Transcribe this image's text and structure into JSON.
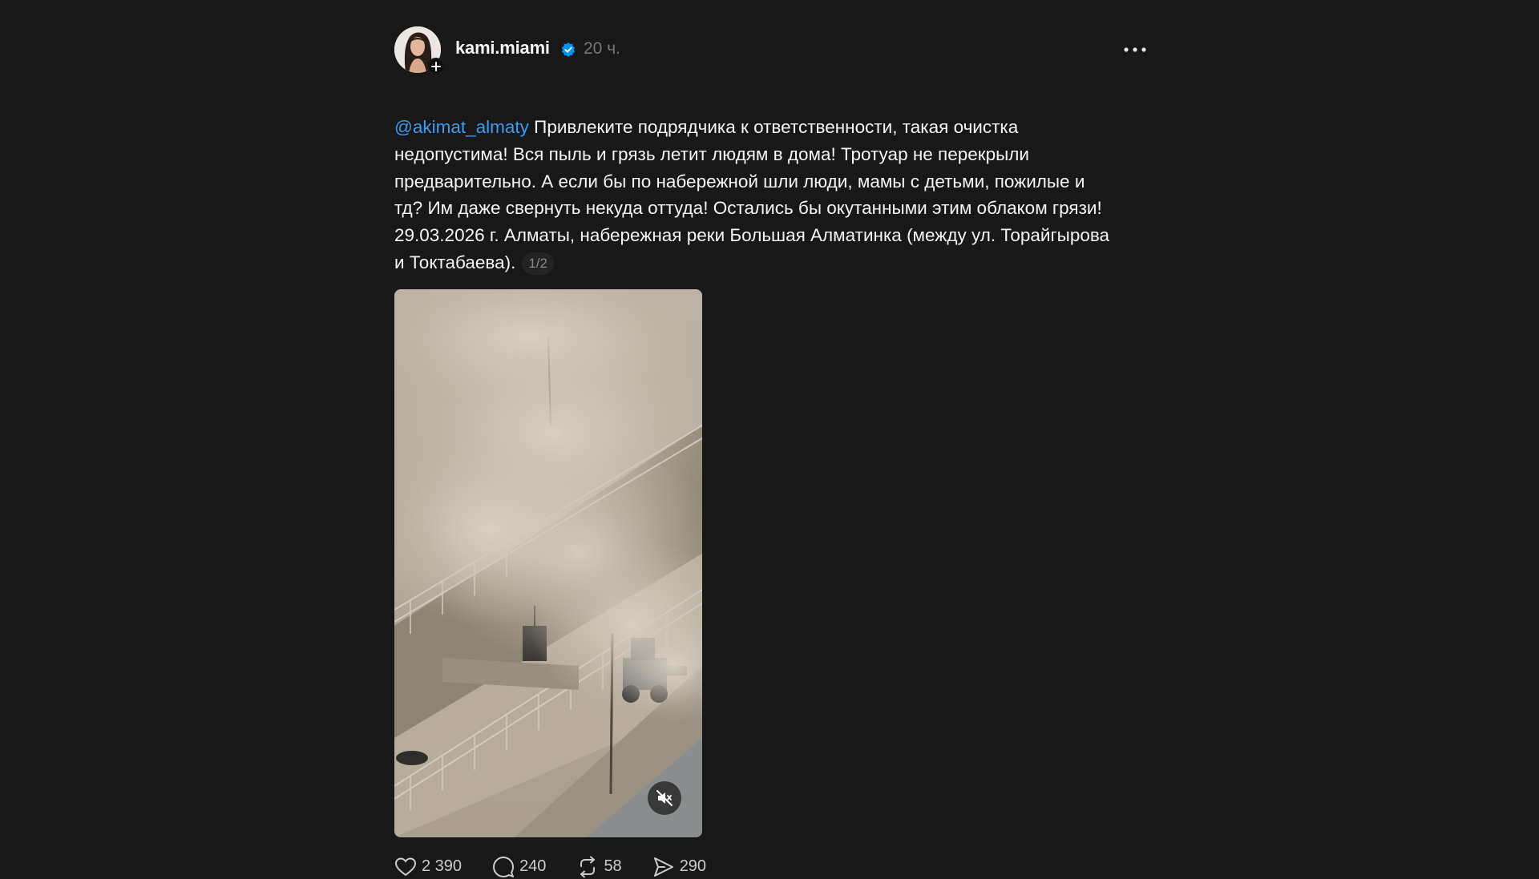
{
  "post": {
    "username": "kami.miami",
    "timestamp": "20 ч.",
    "mention": "@akimat_almaty",
    "text": " Привлеките подрядчика к ответственности, такая очистка\nнедопустима! Вся пыль и грязь летит людям в дома! Тротуар не перекрыли\nпредварительно. А если бы по набережной шли люди, мамы с детьми, пожилые и\nтд? Им даже свернуть некуда оттуда! Остались бы окутанными этим облаком грязи!\n29.03.2026 г. Алматы, набережная реки Большая Алматинка (между ул. Торайгырова\nи Токтабаева).",
    "page_indicator": "1/2"
  },
  "actions": {
    "likes": "2 390",
    "replies": "240",
    "reposts": "58",
    "shares": "290"
  },
  "icons": {
    "avatar": "avatar",
    "follow": "plus-icon",
    "verified": "verified-badge-icon",
    "more": "more-options-icon",
    "mute": "muted-speaker-icon",
    "like": "heart-icon",
    "reply": "comment-icon",
    "repost": "repost-icon",
    "share": "share-icon"
  },
  "colors": {
    "background": "#181818",
    "text": "#f3f5f7",
    "mention": "#3b9bf0",
    "verified": "#0095f6",
    "muted_text": "#777777"
  }
}
